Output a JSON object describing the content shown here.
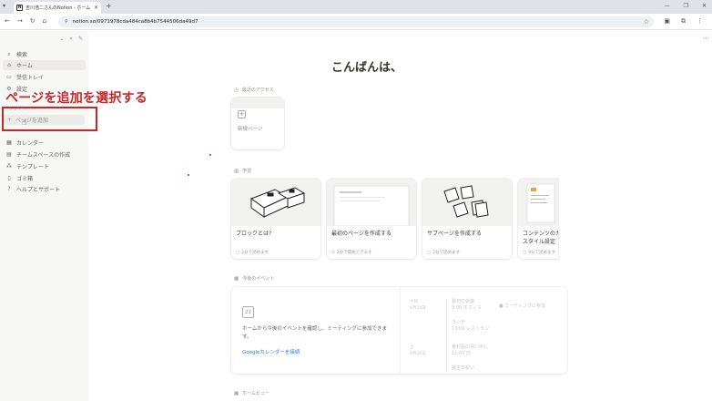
{
  "browser": {
    "tab_title": "吉川浩二さんのNotion - ホーム",
    "tab_close": "✕",
    "new_tab": "+",
    "url": "notion.so/0971978cda484ca8b4b7544506da49d7"
  },
  "sidebar": {
    "items": [
      {
        "icon": "search-icon",
        "glyph": "⌕",
        "label": "検索"
      },
      {
        "icon": "home-icon",
        "glyph": "⌂",
        "label": "ホーム"
      },
      {
        "icon": "inbox-icon",
        "glyph": "▭",
        "label": "受信トレイ"
      },
      {
        "icon": "settings-icon",
        "glyph": "⚙",
        "label": "設定"
      }
    ],
    "section_label": "プライベート",
    "add_page": "ページを追加",
    "bottom_items": [
      {
        "icon": "calendar-icon",
        "glyph": "▦",
        "label": "カレンダー"
      },
      {
        "icon": "teamspace-icon",
        "glyph": "▤",
        "label": "チームスペースの作成"
      },
      {
        "icon": "template-icon",
        "glyph": "⁂",
        "label": "テンプレート"
      },
      {
        "icon": "trash-icon",
        "glyph": "▯",
        "label": "ゴミ箱"
      },
      {
        "icon": "help-icon",
        "glyph": "?",
        "label": "ヘルプとサポート"
      }
    ]
  },
  "annotation": {
    "text": "ページを追加を選択する",
    "color": "#c62828"
  },
  "main": {
    "greeting": "こんばんは、",
    "recent": {
      "header": "最近のアクセス",
      "new_page": "新規ページ"
    },
    "learn": {
      "header": "学習",
      "cards": [
        {
          "title": "ブロックとは?",
          "meta": "2分で読めます"
        },
        {
          "title": "最初のページを作成する",
          "meta": "2分で開始できます"
        },
        {
          "title": "サブページを作成する",
          "meta": "2分で読めます"
        },
        {
          "title": "コンテンツのカ…\nスタイル設定",
          "meta": "9分で読めます"
        }
      ]
    },
    "events": {
      "header": "今後のイベント",
      "calendar_day": "21",
      "description": "ホームから今後のイベントを確認し、ミーティングに参加できます。",
      "link": "Googleカレンダーを接続",
      "day1_label": "今日",
      "day1_date": "4月24日",
      "day2_label": "土",
      "day2_date": "4月26日",
      "event1_title": "最初の会議",
      "event1_detail": "9:00 オフィス",
      "event2_title": "ランチ",
      "event2_detail": "13:00 レストラン",
      "event3_title": "食料品の買い出し",
      "event3_detail": "11:00 店",
      "event4_title": "誕生日祝い",
      "join": "ミーティングに参加"
    },
    "home_view": "ホームビュー"
  },
  "colors": {
    "sidebar_bg": "#f7f7f5",
    "accent_link": "#2383e2",
    "annotation_red": "#c62828"
  }
}
